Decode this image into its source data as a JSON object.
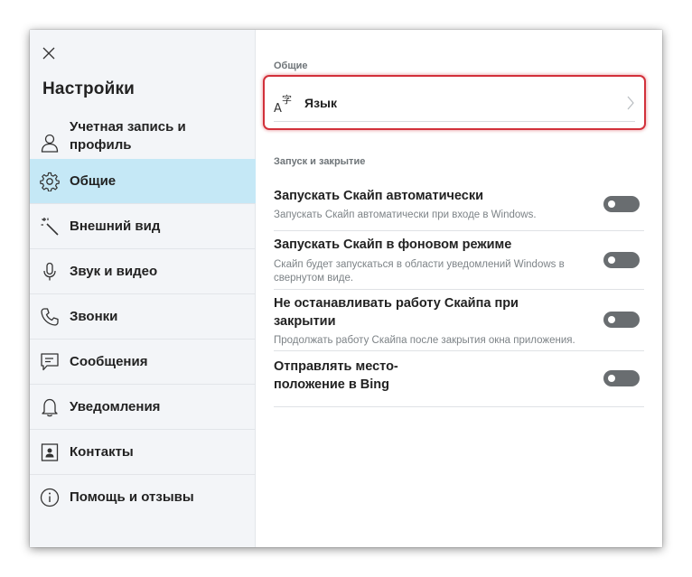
{
  "sidebar": {
    "title": "Настройки",
    "items": [
      {
        "label": "Учетная запись и профиль",
        "icon": "person-icon"
      },
      {
        "label": "Общие",
        "icon": "gear-icon",
        "active": true
      },
      {
        "label": "Внешний вид",
        "icon": "magic-wand-icon"
      },
      {
        "label": "Звук и видео",
        "icon": "microphone-icon"
      },
      {
        "label": "Звонки",
        "icon": "phone-icon"
      },
      {
        "label": "Сообщения",
        "icon": "message-icon"
      },
      {
        "label": "Уведомления",
        "icon": "bell-icon"
      },
      {
        "label": "Контакты",
        "icon": "contacts-icon"
      },
      {
        "label": "Помощь и отзывы",
        "icon": "info-icon"
      }
    ]
  },
  "main": {
    "section_general": "Общие",
    "language_label": "Язык",
    "section_startup": "Запуск и закрытие",
    "settings": [
      {
        "title": "Запускать Скайп автоматически",
        "description": "Запускать Скайп автоматически при входе в Windows.",
        "enabled": false
      },
      {
        "title": "Запускать Скайп в фоновом режиме",
        "description": "Скайп будет запускаться в области уведомлений Windows в свернутом виде.",
        "enabled": false
      },
      {
        "title": "Не останавливать работу Скайпа при закрытии",
        "description": "Продолжать работу Скайпа после закрытия окна приложения.",
        "enabled": false
      },
      {
        "title": "Отправлять место-положение в Bing",
        "description": "",
        "enabled": false
      }
    ]
  },
  "colors": {
    "active_item_bg": "#c5e8f6",
    "highlight_border": "#d2303a",
    "toggle_off": "#696d70"
  }
}
